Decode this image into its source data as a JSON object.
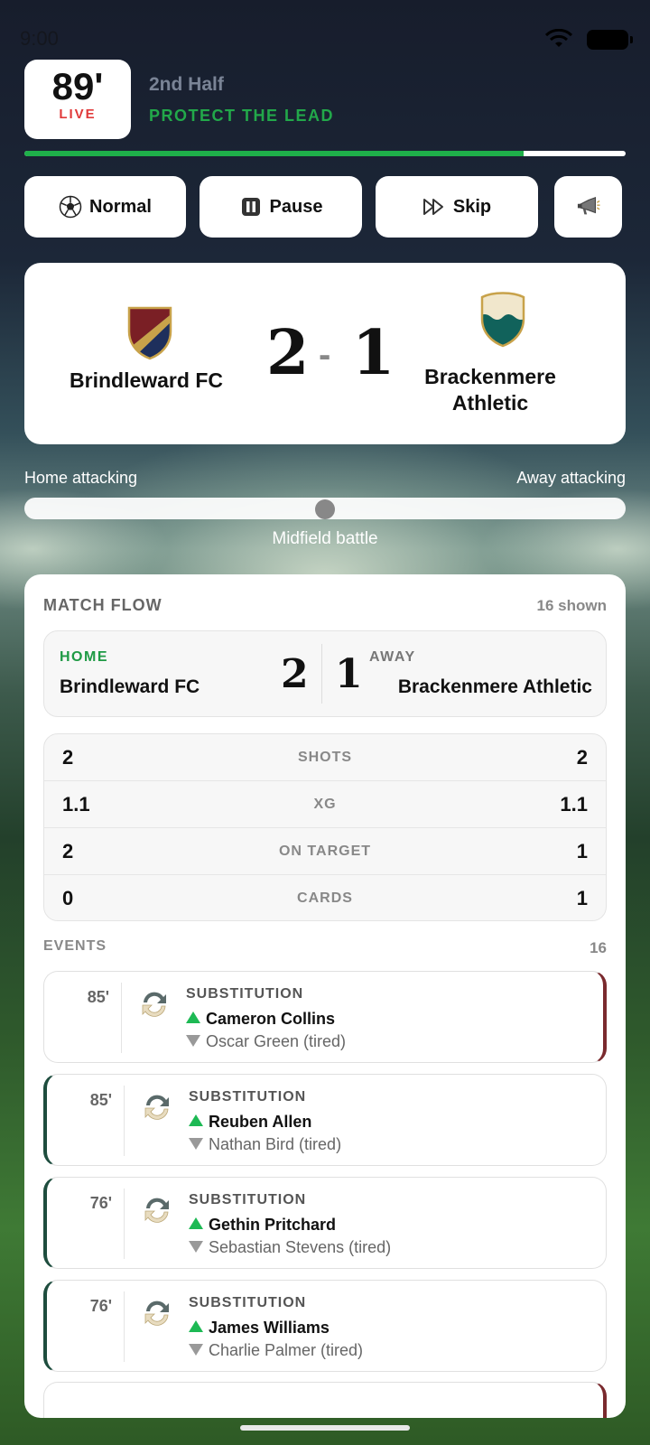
{
  "status_bar": {
    "time": "9:00"
  },
  "match_clock": {
    "minute": "89'",
    "live_label": "LIVE",
    "phase": "2nd Half",
    "tactic": "PROTECT THE LEAD",
    "progress_percent": 83
  },
  "controls": [
    {
      "label": "Normal",
      "icon": "soccer-ball-icon"
    },
    {
      "label": "Pause",
      "icon": "pause-icon"
    },
    {
      "label": "Skip",
      "icon": "fast-forward-icon"
    },
    {
      "label": "",
      "icon": "megaphone-icon"
    }
  ],
  "scoreboard": {
    "home": {
      "name": "Brindleward FC",
      "score": "2",
      "crest_colors": [
        "#7a1f25",
        "#1e2f5c",
        "#c8a24a"
      ]
    },
    "away": {
      "name": "Brackenmere Athletic",
      "score": "1",
      "crest_colors": [
        "#f1e7cc",
        "#11625b",
        "#c8a24a"
      ]
    },
    "separator": "-"
  },
  "momentum": {
    "left_label": "Home attacking",
    "right_label": "Away attacking",
    "state_label": "Midfield battle",
    "value": 0.5
  },
  "match_flow": {
    "title": "MATCH FLOW",
    "count_label": "16 shown",
    "home_label": "HOME",
    "away_label": "AWAY",
    "home_name": "Brindleward FC",
    "away_name": "Brackenmere Athletic",
    "home_score": "2",
    "away_score": "1",
    "stats": [
      {
        "label": "SHOTS",
        "home": "2",
        "away": "2"
      },
      {
        "label": "XG",
        "home": "1.1",
        "away": "1.1"
      },
      {
        "label": "ON TARGET",
        "home": "2",
        "away": "1"
      },
      {
        "label": "CARDS",
        "home": "0",
        "away": "1"
      }
    ]
  },
  "events": {
    "title": "EVENTS",
    "count": "16",
    "items": [
      {
        "minute": "85'",
        "type": "SUBSTITUTION",
        "side": "away",
        "player_on": "Cameron Collins",
        "player_off": "Oscar Green (tired)"
      },
      {
        "minute": "85'",
        "type": "SUBSTITUTION",
        "side": "home",
        "player_on": "Reuben Allen",
        "player_off": "Nathan Bird (tired)"
      },
      {
        "minute": "76'",
        "type": "SUBSTITUTION",
        "side": "home",
        "player_on": "Gethin Pritchard",
        "player_off": "Sebastian Stevens (tired)"
      },
      {
        "minute": "76'",
        "type": "SUBSTITUTION",
        "side": "home",
        "player_on": "James Williams",
        "player_off": "Charlie Palmer (tired)"
      }
    ]
  },
  "colors": {
    "accent_green": "#1fb04a",
    "live_red": "#e03a3a",
    "home_bar": "#1e4d3e",
    "away_bar": "#7a2a2e"
  }
}
